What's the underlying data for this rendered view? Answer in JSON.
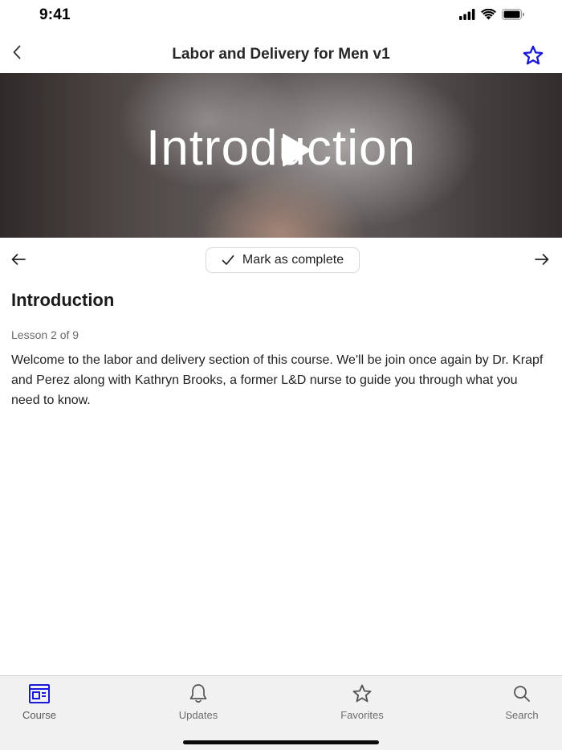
{
  "status_bar": {
    "time": "9:41"
  },
  "header": {
    "title": "Labor and Delivery for Men v1"
  },
  "video": {
    "overlay_title": "Introduction"
  },
  "lesson_nav": {
    "mark_complete_label": "Mark as complete"
  },
  "lesson": {
    "title": "Introduction",
    "progress": "Lesson 2 of 9",
    "description": "Welcome to the labor and delivery section of this course. We'll be join once again by Dr. Krapf and Perez along with Kathryn Brooks, a former L&D nurse to guide you through what you need to know."
  },
  "tabs": [
    {
      "label": "Course",
      "icon": "course-icon",
      "active": true
    },
    {
      "label": "Updates",
      "icon": "bell-icon",
      "active": false
    },
    {
      "label": "Favorites",
      "icon": "star-icon",
      "active": false
    },
    {
      "label": "Search",
      "icon": "search-icon",
      "active": false
    }
  ],
  "colors": {
    "accent": "#1a1ad6",
    "tab_bar_bg": "#f1f1f1"
  }
}
